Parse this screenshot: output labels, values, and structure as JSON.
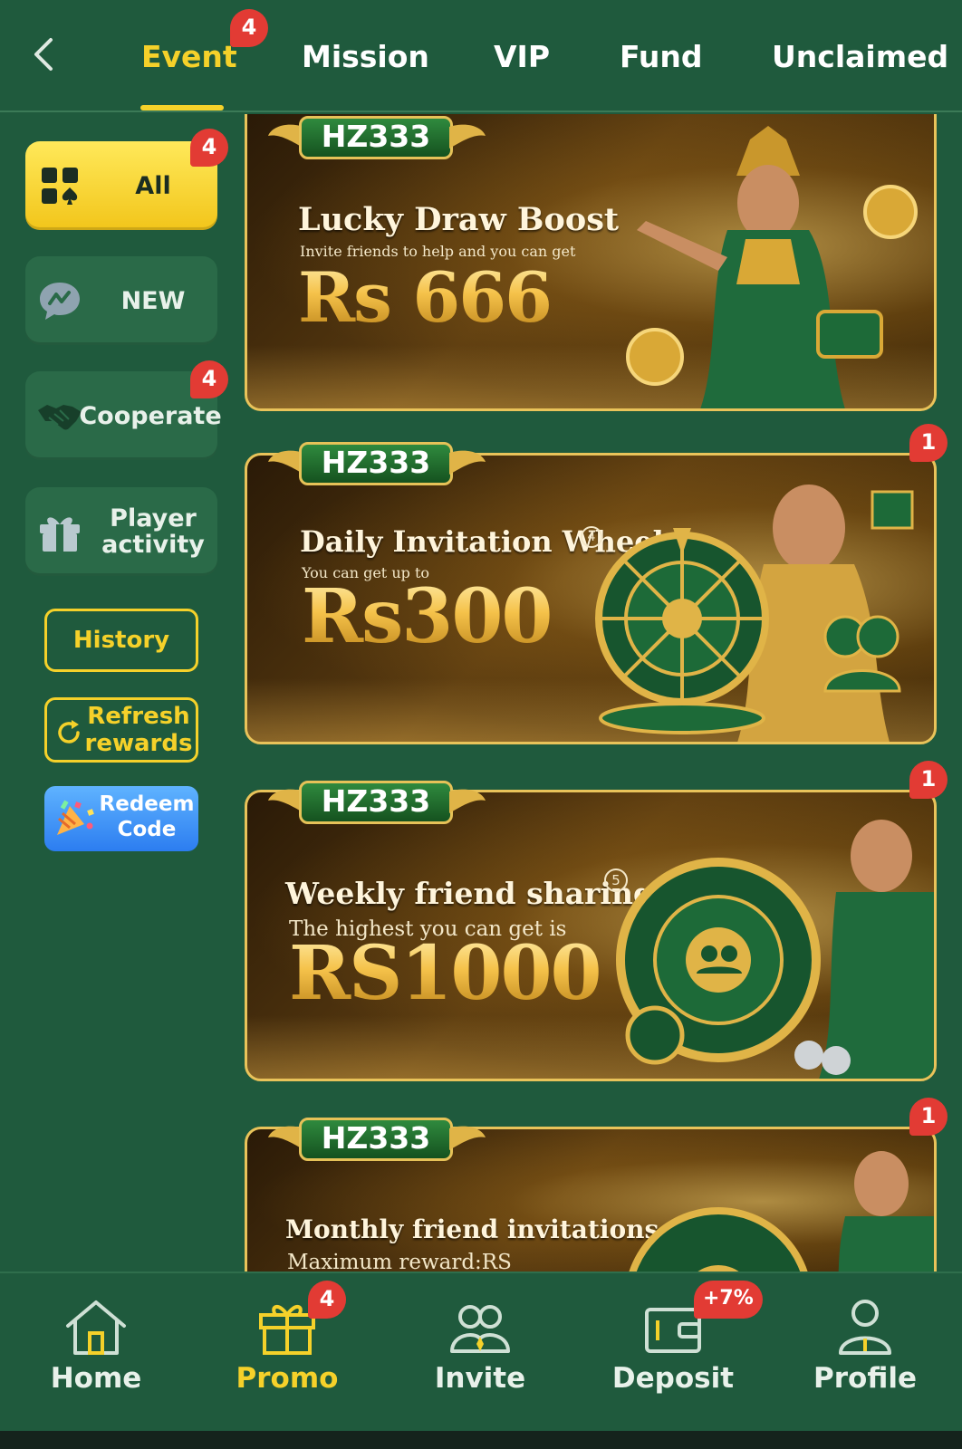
{
  "topnav": {
    "tabs": [
      {
        "label": "Event",
        "badge": "4"
      },
      {
        "label": "Mission"
      },
      {
        "label": "VIP"
      },
      {
        "label": "Fund"
      },
      {
        "label": "Unclaimed"
      }
    ]
  },
  "sidebar": {
    "categories": [
      {
        "label": "All",
        "badge": "4"
      },
      {
        "label": "NEW"
      },
      {
        "label": "Cooperate",
        "badge": "4"
      },
      {
        "label": "Player activity"
      }
    ],
    "history_label": "History",
    "refresh_label": "Refresh rewards",
    "redeem_label": "Redeem Code"
  },
  "banners": [
    {
      "brand": "HZ333",
      "headline": "Lucky Draw Boost",
      "sub": "Invite friends to help and you can get",
      "amount": "Rs 666",
      "badge": ""
    },
    {
      "brand": "HZ333",
      "headline": "Daily Invitation Wheel",
      "sub": "You can get up to",
      "amount": "Rs300",
      "badge": "1",
      "mark": "4"
    },
    {
      "brand": "HZ333",
      "headline": "Weekly friend sharing",
      "sub": "The highest you can get is",
      "amount": "RS1000",
      "badge": "1",
      "mark": "5"
    },
    {
      "brand": "HZ333",
      "headline": "Monthly friend invitations",
      "sub": "Maximum reward:RS",
      "amount": "",
      "badge": "1"
    }
  ],
  "bottomnav": {
    "items": [
      {
        "label": "Home",
        "icon": "home-icon"
      },
      {
        "label": "Promo",
        "icon": "gift-icon",
        "badge": "4"
      },
      {
        "label": "Invite",
        "icon": "users-icon"
      },
      {
        "label": "Deposit",
        "icon": "wallet-icon",
        "badge": "+7%"
      },
      {
        "label": "Profile",
        "icon": "person-icon"
      }
    ]
  },
  "colors": {
    "background": "#1f5a3d",
    "accent": "#f5d12a",
    "badge": "#e23b34"
  }
}
